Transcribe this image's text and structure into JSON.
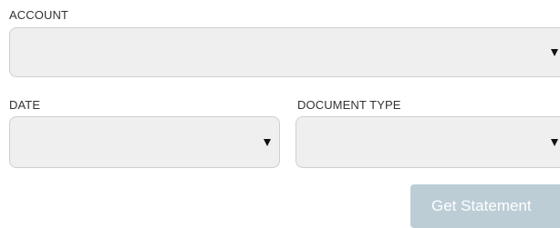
{
  "form": {
    "account": {
      "label": "ACCOUNT",
      "value": ""
    },
    "date": {
      "label": "DATE",
      "value": ""
    },
    "document_type": {
      "label": "DOCUMENT TYPE",
      "value": ""
    },
    "submit_label": "Get Statement"
  },
  "colors": {
    "select_background": "#efefef",
    "select_border": "#cfcfcf",
    "button_background": "#bccdd6",
    "button_text": "#ffffff",
    "label_text": "#333333"
  },
  "icons": {
    "dropdown_arrow": "triangle-down-icon"
  }
}
